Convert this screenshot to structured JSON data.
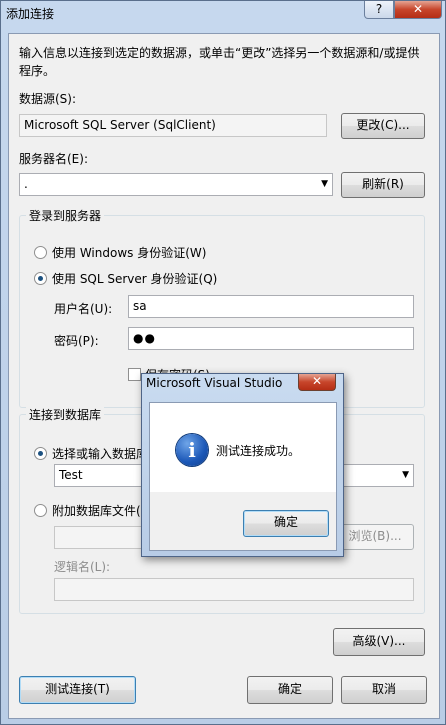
{
  "window": {
    "title": "添加连接",
    "help_glyph": "?",
    "close_glyph": "✕"
  },
  "description": "输入信息以连接到选定的数据源，或单击“更改”选择另一个数据源和/或提供程序。",
  "datasource": {
    "label": "数据源(S):",
    "value": "Microsoft SQL Server (SqlClient)",
    "change_button": "更改(C)..."
  },
  "server": {
    "label": "服务器名(E):",
    "value": ".",
    "refresh_button": "刷新(R)"
  },
  "login": {
    "group_title": "登录到服务器",
    "windows_auth": "使用 Windows 身份验证(W)",
    "sql_auth": "使用 SQL Server 身份验证(Q)",
    "username_label": "用户名(U):",
    "username_value": "sa",
    "password_label": "密码(P):",
    "password_value": "●●",
    "save_password": "保存密码(S)"
  },
  "database": {
    "group_title": "连接到数据库",
    "select_option": "选择或输入数据库名",
    "db_value": "Test",
    "attach_option": "附加数据库文件(H)",
    "browse_button": "浏览(B)...",
    "logical_name_label": "逻辑名(L):"
  },
  "advanced_button": "高级(V)...",
  "footer": {
    "test_button": "测试连接(T)",
    "ok_button": "确定",
    "cancel_button": "取消"
  },
  "messagebox": {
    "title": "Microsoft Visual Studio",
    "close_glyph": "✕",
    "message": "测试连接成功。",
    "icon_glyph": "i",
    "ok_button": "确定"
  }
}
